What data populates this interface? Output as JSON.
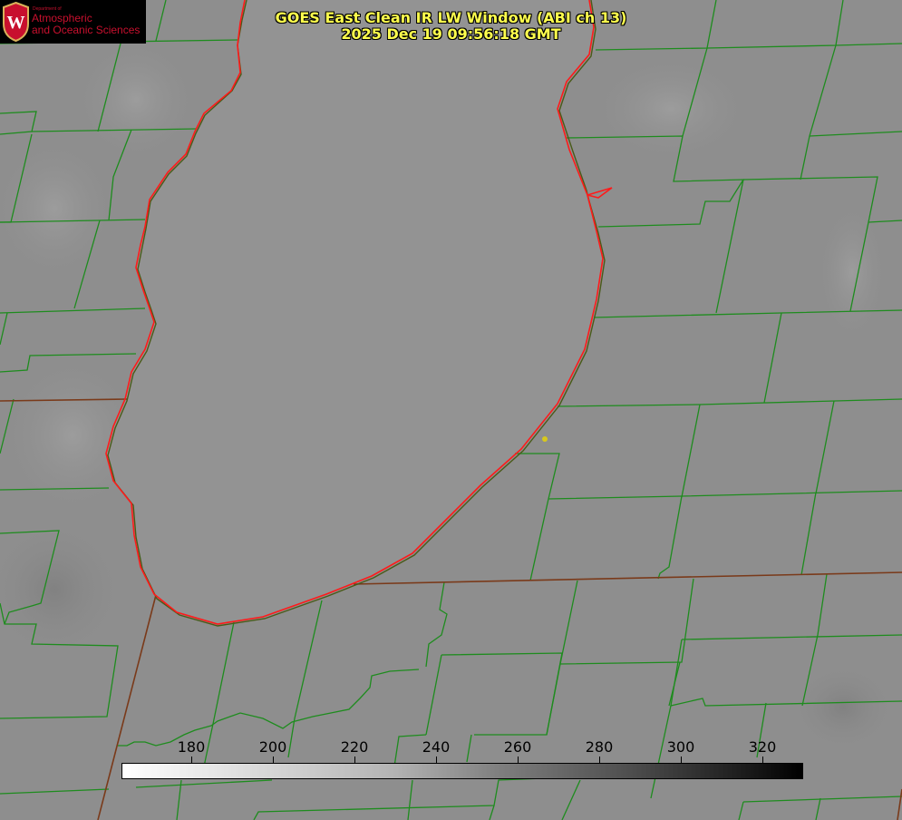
{
  "title": {
    "line1": "GOES East Clean IR LW Window (ABI ch 13)",
    "line2": "2025 Dec 19 09:56:18 GMT"
  },
  "logo": {
    "department": "Department of",
    "line1": "Atmospheric",
    "line2": "and Oceanic Sciences",
    "seal_letter": "W"
  },
  "colorbar": {
    "ticks": [
      "180",
      "200",
      "220",
      "240",
      "260",
      "280",
      "300",
      "320"
    ],
    "tick_values": [
      180,
      200,
      220,
      240,
      260,
      280,
      300,
      320
    ],
    "range": [
      163,
      330
    ],
    "colormap": "white-to-black grayscale"
  },
  "map": {
    "background_color": "#8e8e8e",
    "county_line_color": "#1e8c1e",
    "lake_shore_color": "#ff1a1a",
    "state_border_color": "#7a3a1a",
    "marker_color": "#d8c81c"
  }
}
